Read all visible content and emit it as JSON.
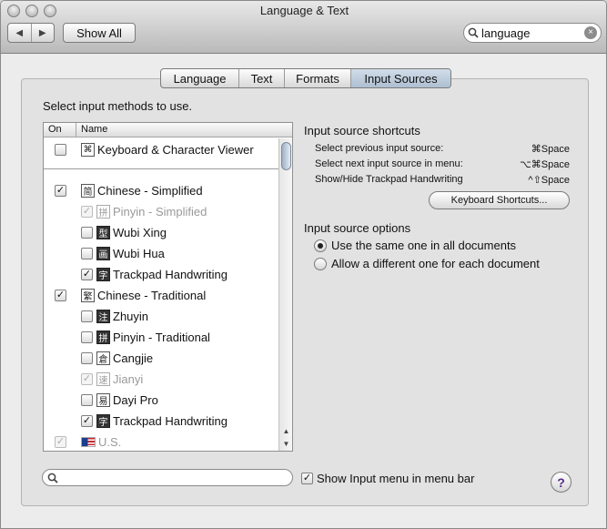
{
  "window": {
    "title": "Language & Text"
  },
  "toolbar": {
    "back_icon": "◀",
    "forward_icon": "▶",
    "show_all_label": "Show All",
    "search_value": "language",
    "search_clear_icon": "×"
  },
  "tabs": [
    {
      "label": "Language",
      "selected": false
    },
    {
      "label": "Text",
      "selected": false
    },
    {
      "label": "Formats",
      "selected": false
    },
    {
      "label": "Input Sources",
      "selected": true
    }
  ],
  "instructions": "Select input methods to use.",
  "list": {
    "col_on": "On",
    "col_name": "Name",
    "items": [
      {
        "label": "Keyboard & Character Viewer",
        "checked": false,
        "enabled": true,
        "glyph": "⌘",
        "glyph_style": "light"
      },
      {
        "label": "Chinese - Simplified",
        "checked": true,
        "enabled": true,
        "glyph": "简",
        "glyph_style": "light"
      },
      {
        "label": "Pinyin - Simplified",
        "checked": true,
        "enabled": false,
        "glyph": "拼",
        "glyph_style": "dim"
      },
      {
        "label": "Wubi Xing",
        "checked": false,
        "enabled": true,
        "glyph": "型",
        "glyph_style": "dark"
      },
      {
        "label": "Wubi Hua",
        "checked": false,
        "enabled": true,
        "glyph": "画",
        "glyph_style": "dark"
      },
      {
        "label": "Trackpad Handwriting",
        "checked": true,
        "enabled": true,
        "glyph": "字",
        "glyph_style": "dark"
      },
      {
        "label": "Chinese - Traditional",
        "checked": true,
        "enabled": true,
        "glyph": "繁",
        "glyph_style": "light"
      },
      {
        "label": "Zhuyin",
        "checked": false,
        "enabled": true,
        "glyph": "注",
        "glyph_style": "dark"
      },
      {
        "label": "Pinyin - Traditional",
        "checked": false,
        "enabled": true,
        "glyph": "拼",
        "glyph_style": "dark"
      },
      {
        "label": "Cangjie",
        "checked": false,
        "enabled": true,
        "glyph": "倉",
        "glyph_style": "light"
      },
      {
        "label": "Jianyi",
        "checked": true,
        "enabled": false,
        "glyph": "速",
        "glyph_style": "dim"
      },
      {
        "label": "Dayi Pro",
        "checked": false,
        "enabled": true,
        "glyph": "易",
        "glyph_style": "light"
      },
      {
        "label": "Trackpad Handwriting",
        "checked": true,
        "enabled": true,
        "glyph": "字",
        "glyph_style": "dark"
      },
      {
        "label": "U.S.",
        "checked": true,
        "enabled": false,
        "glyph": "us-flag",
        "glyph_style": "flag"
      }
    ],
    "check_mark": "✓",
    "scroll_up": "▲",
    "scroll_down": "▼"
  },
  "shortcuts": {
    "heading": "Input source shortcuts",
    "rows": [
      {
        "label": "Select previous input source:",
        "keys": "⌘Space"
      },
      {
        "label": "Select next input source in menu:",
        "keys": "⌥⌘Space"
      },
      {
        "label": "Show/Hide Trackpad Handwriting",
        "keys": "^⇧Space"
      }
    ],
    "button_label": "Keyboard Shortcuts..."
  },
  "options": {
    "heading": "Input source options",
    "radios": [
      {
        "label": "Use the same one in all documents",
        "selected": true
      },
      {
        "label": "Allow a different one for each document",
        "selected": false
      }
    ]
  },
  "footer": {
    "search_value": "",
    "show_menu_label": "Show Input menu in menu bar",
    "show_menu_checked": true,
    "help_label": "?"
  },
  "colors": {
    "selected_tab": "#bfcddc",
    "window_bg": "#ececec",
    "panel_bg": "#e2e2e2"
  }
}
